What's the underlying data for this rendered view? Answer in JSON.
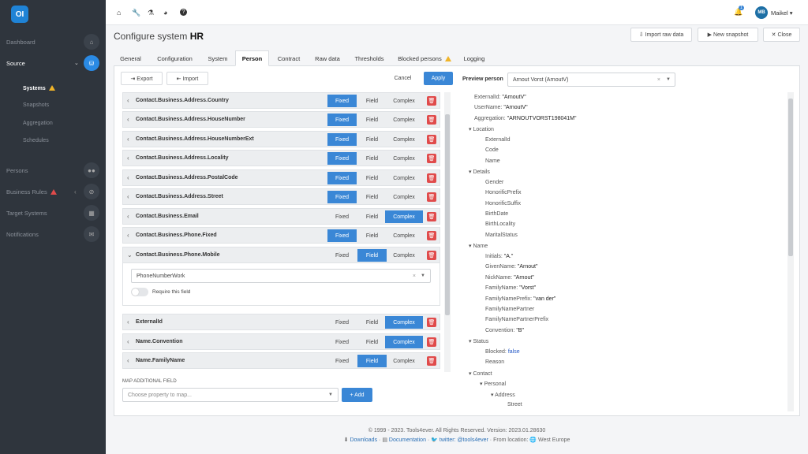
{
  "app": {
    "logo": "OI"
  },
  "sidebar": {
    "items": [
      {
        "label": "Dashboard",
        "icon": "home-icon",
        "glyph": "⌂"
      },
      {
        "label": "Source",
        "icon": "database-icon",
        "glyph": "⛁"
      },
      {
        "label": "Persons",
        "icon": "users-icon",
        "glyph": "👥"
      },
      {
        "label": "Business Rules",
        "icon": "ban-icon",
        "glyph": "⊘"
      },
      {
        "label": "Target Systems",
        "icon": "grid-icon",
        "glyph": "▦"
      },
      {
        "label": "Notifications",
        "icon": "envelope-icon",
        "glyph": "✉"
      }
    ],
    "sub": [
      "Systems",
      "Snapshots",
      "Aggregation",
      "Schedules"
    ]
  },
  "topbar": {
    "icons": [
      "⌂",
      "🔧",
      "⚗",
      "◕",
      "?"
    ],
    "bell_badge": "1",
    "user_initials": "MB",
    "user_name": "Maikel ▾"
  },
  "header": {
    "title_prefix": "Configure system",
    "title_bold": "HR",
    "import_raw": "⇩ Import raw data",
    "new_snapshot": "▶ New snapshot",
    "close": "✕ Close"
  },
  "tabs": [
    "General",
    "Configuration",
    "System",
    "Person",
    "Contract",
    "Raw data",
    "Thresholds",
    "Blocked persons",
    "Logging"
  ],
  "toolbar": {
    "export": "⇥ Export",
    "import": "⇤ Import",
    "cancel": "Cancel",
    "apply": "Apply"
  },
  "options": {
    "fixed": "Fixed",
    "field": "Field",
    "complex": "Complex"
  },
  "mappings": [
    {
      "name": "Contact.Business.Address.Country",
      "selected": "fixed"
    },
    {
      "name": "Contact.Business.Address.HouseNumber",
      "selected": "fixed"
    },
    {
      "name": "Contact.Business.Address.HouseNumberExt",
      "selected": "fixed"
    },
    {
      "name": "Contact.Business.Address.Locality",
      "selected": "fixed"
    },
    {
      "name": "Contact.Business.Address.PostalCode",
      "selected": "fixed"
    },
    {
      "name": "Contact.Business.Address.Street",
      "selected": "fixed"
    },
    {
      "name": "Contact.Business.Email",
      "selected": "complex"
    },
    {
      "name": "Contact.Business.Phone.Fixed",
      "selected": "fixed"
    },
    {
      "name": "Contact.Business.Phone.Mobile",
      "selected": "field",
      "expanded": true
    },
    {
      "name": "ExternalId",
      "selected": "complex"
    },
    {
      "name": "Name.Convention",
      "selected": "complex"
    },
    {
      "name": "Name.FamilyName",
      "selected": "field"
    }
  ],
  "expanded": {
    "field_value": "PhoneNumberWork",
    "require_label": "Require this field"
  },
  "map_additional": {
    "label": "MAP ADDITIONAL FIELD",
    "placeholder": "Choose property to map...",
    "add": "+ Add"
  },
  "preview": {
    "label": "Preview person",
    "value": "Arnout Vorst (ArnoutV)"
  },
  "tree": [
    {
      "d": 0,
      "k": "ExternalId:",
      "v": "\"ArnoutV\""
    },
    {
      "d": 0,
      "k": "UserName:",
      "v": "\"ArnoutV\""
    },
    {
      "d": 0,
      "k": "Aggregation:",
      "v": "\"ARNOUTVORST198041M\""
    },
    {
      "d": 0,
      "k": "▾ Location",
      "v": "",
      "node": true
    },
    {
      "d": 1,
      "k": "ExternalId",
      "v": ""
    },
    {
      "d": 1,
      "k": "Code",
      "v": ""
    },
    {
      "d": 1,
      "k": "Name",
      "v": ""
    },
    {
      "d": 0,
      "k": "▾ Details",
      "v": "",
      "node": true
    },
    {
      "d": 1,
      "k": "Gender",
      "v": ""
    },
    {
      "d": 1,
      "k": "HonorificPrefix",
      "v": ""
    },
    {
      "d": 1,
      "k": "HonorificSuffix",
      "v": ""
    },
    {
      "d": 1,
      "k": "BirthDate",
      "v": ""
    },
    {
      "d": 1,
      "k": "BirthLocality",
      "v": ""
    },
    {
      "d": 1,
      "k": "MaritalStatus",
      "v": ""
    },
    {
      "d": 0,
      "k": "▾ Name",
      "v": "",
      "node": true
    },
    {
      "d": 1,
      "k": "Initials:",
      "v": "\"A.\""
    },
    {
      "d": 1,
      "k": "GivenName:",
      "v": "\"Arnout\""
    },
    {
      "d": 1,
      "k": "NickName:",
      "v": "\"Arnout\""
    },
    {
      "d": 1,
      "k": "FamilyName:",
      "v": "\"Vorst\""
    },
    {
      "d": 1,
      "k": "FamilyNamePrefix:",
      "v": "\"van der\""
    },
    {
      "d": 1,
      "k": "FamilyNamePartner",
      "v": ""
    },
    {
      "d": 1,
      "k": "FamilyNamePartnerPrefix",
      "v": ""
    },
    {
      "d": 1,
      "k": "Convention:",
      "v": "\"B\""
    },
    {
      "d": 0,
      "k": "▾ Status",
      "v": "",
      "node": true
    },
    {
      "d": 1,
      "k": "Blocked:",
      "v": "false",
      "bool": true
    },
    {
      "d": 1,
      "k": "Reason",
      "v": ""
    },
    {
      "d": 0,
      "k": "▾ Contact",
      "v": "",
      "node": true
    },
    {
      "d": 1,
      "k": "▾ Personal",
      "v": "",
      "node": true
    },
    {
      "d": 2,
      "k": "▾ Address",
      "v": "",
      "node": true
    },
    {
      "d": 3,
      "k": "Street",
      "v": ""
    }
  ],
  "footer": {
    "line1": "© 1999 - 2023. Tools4ever. All Rights Reserved. Version: 2023.01.28630",
    "downloads": "Downloads",
    "documentation": "Documentation",
    "twitter": "twitter: @tools4ever",
    "location": "From location: 🌐 West Europe"
  }
}
